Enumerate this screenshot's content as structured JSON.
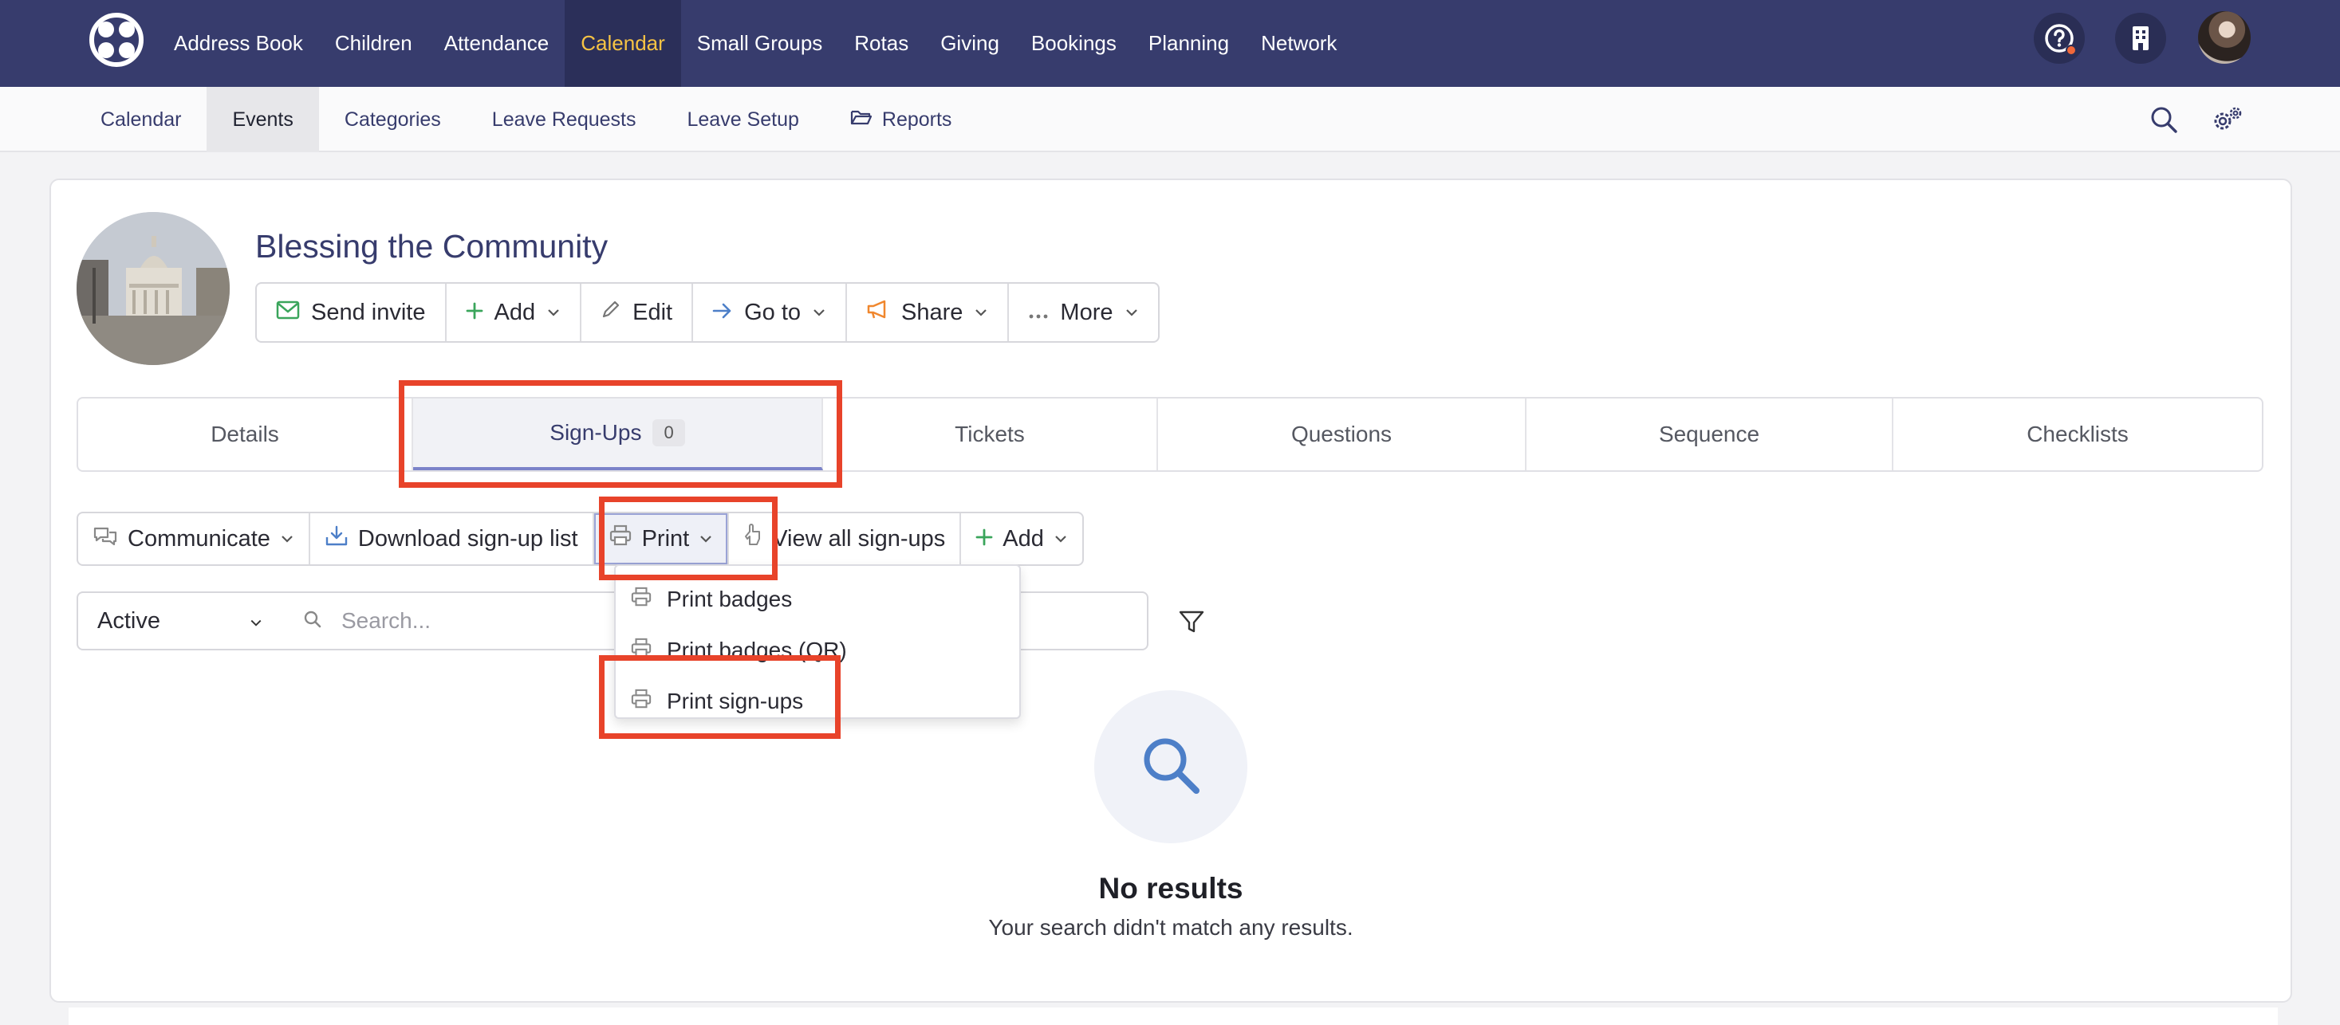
{
  "topnav": {
    "items": [
      {
        "label": "Address Book"
      },
      {
        "label": "Children"
      },
      {
        "label": "Attendance"
      },
      {
        "label": "Calendar",
        "active": true
      },
      {
        "label": "Small Groups"
      },
      {
        "label": "Rotas"
      },
      {
        "label": "Giving"
      },
      {
        "label": "Bookings"
      },
      {
        "label": "Planning"
      },
      {
        "label": "Network"
      }
    ],
    "accent_color": "#f6c344",
    "bar_color": "#373c6d"
  },
  "subnav": {
    "items": [
      {
        "label": "Calendar"
      },
      {
        "label": "Events",
        "active": true
      },
      {
        "label": "Categories"
      },
      {
        "label": "Leave Requests"
      },
      {
        "label": "Leave Setup"
      },
      {
        "label": "Reports",
        "icon": "folder-open-icon"
      }
    ]
  },
  "event": {
    "title": "Blessing the Community",
    "actions": [
      {
        "label": "Send invite",
        "icon": "envelope-icon"
      },
      {
        "label": "Add",
        "icon": "plus-icon"
      },
      {
        "label": "Edit",
        "icon": "pencil-icon"
      },
      {
        "label": "Go to",
        "icon": "arrow-right-icon"
      },
      {
        "label": "Share",
        "icon": "megaphone-icon"
      },
      {
        "label": "More",
        "icon": "ellipsis-icon"
      }
    ]
  },
  "tabs": [
    {
      "label": "Details"
    },
    {
      "label": "Sign-Ups",
      "badge": "0",
      "active": true
    },
    {
      "label": "Tickets"
    },
    {
      "label": "Questions"
    },
    {
      "label": "Sequence"
    },
    {
      "label": "Checklists"
    }
  ],
  "toolbar": {
    "communicate": "Communicate",
    "download": "Download sign-up list",
    "print": "Print",
    "view_all": "View all sign-ups",
    "add": "Add"
  },
  "print_menu": {
    "items": [
      {
        "label": "Print badges"
      },
      {
        "label": "Print badges (QR)"
      },
      {
        "label": "Print sign-ups"
      }
    ]
  },
  "filters": {
    "status": "Active",
    "search_placeholder": "Search..."
  },
  "empty_state": {
    "title": "No results",
    "subtitle": "Your search didn't match any results."
  },
  "highlight_color": "#e8432a"
}
